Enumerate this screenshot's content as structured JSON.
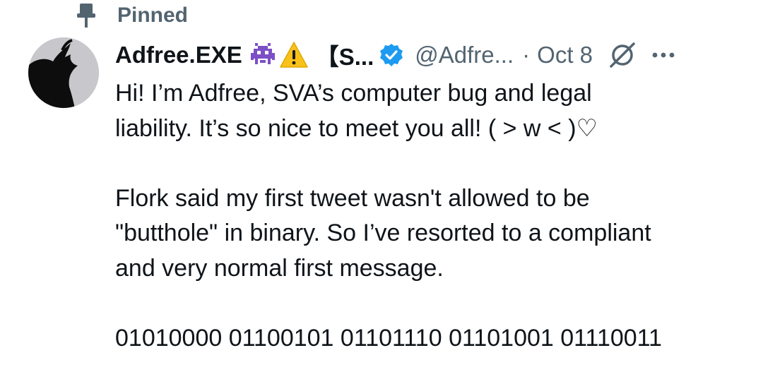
{
  "pinned": {
    "label": "Pinned",
    "icon": "pin-icon"
  },
  "author": {
    "display_name": "Adfree.EXE",
    "name_suffix": "【S...",
    "handle": "@Adfre...",
    "separator": "·",
    "date": "Oct 8",
    "emojis": [
      "alien-monster-icon",
      "warning-icon"
    ],
    "verified_color": "#1d9bf0"
  },
  "tweet": {
    "paragraphs": [
      [
        "Hi! I’m Adfree, SVA’s computer bug and legal",
        "liability. It’s so nice to meet you all! ( > w < )♡"
      ],
      [
        "Flork said my first tweet wasn't allowed to be",
        "\"butthole\" in binary. So I’ve resorted to a compliant",
        "and very normal first message."
      ],
      [
        "01010000 01100101 01101110 01101001 01110011"
      ]
    ]
  },
  "colors": {
    "text": "#0f1419",
    "secondary": "#536471"
  }
}
